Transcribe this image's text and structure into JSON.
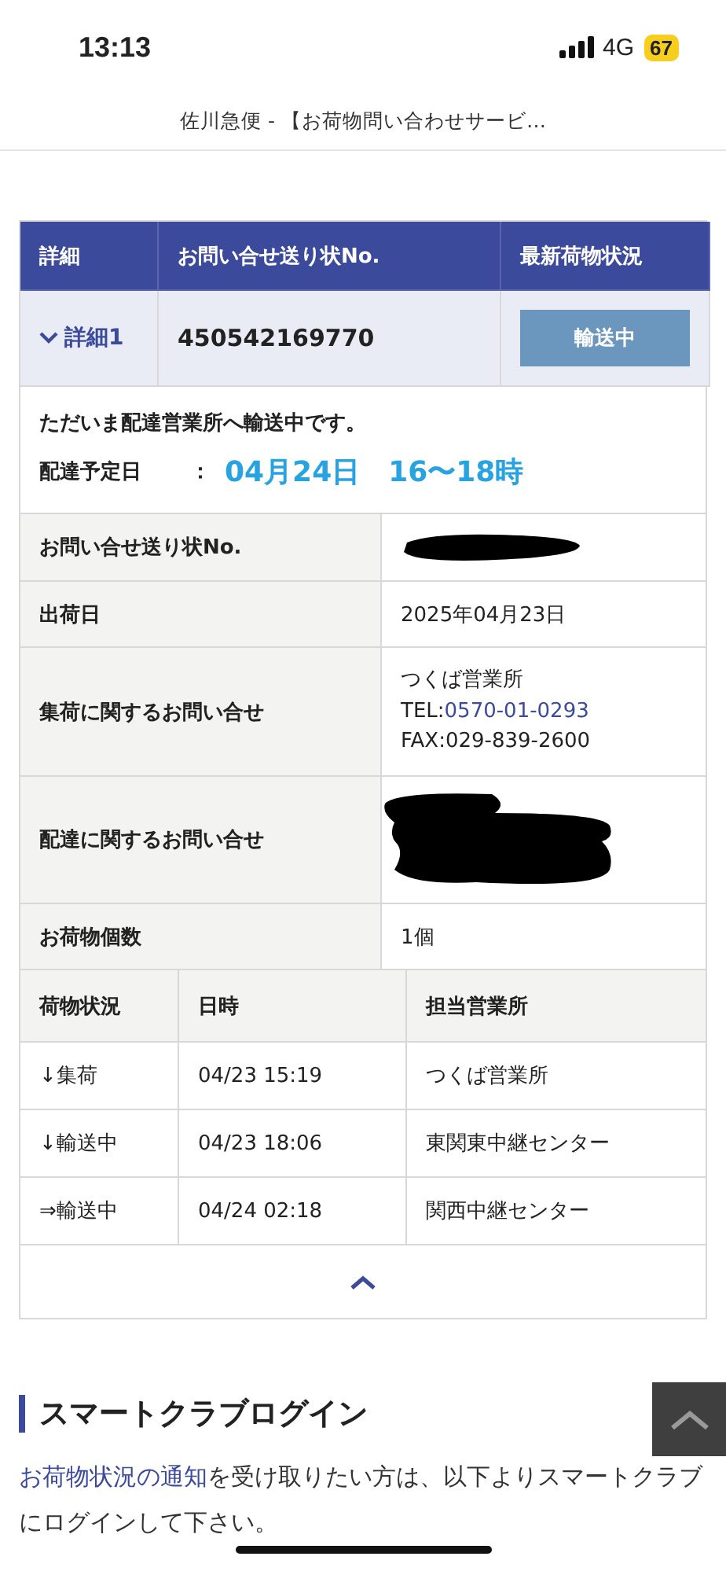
{
  "status_bar": {
    "time": "13:13",
    "network": "4G",
    "battery": "67"
  },
  "page_title": "佐川急便 - 【お荷物問い合わせサービ…",
  "summary_table": {
    "columns": [
      "詳細",
      "お問い合せ送り状No.",
      "最新荷物状況"
    ],
    "row": {
      "detail_link": "詳細1",
      "expanded": true,
      "tracking_no": "450542169770",
      "status": "輸送中"
    }
  },
  "message": "ただいま配達営業所へ輸送中です。",
  "delivery_eta": {
    "label": "配達予定日",
    "separator": "：",
    "date": "04月24日",
    "time": "16〜18時"
  },
  "info_rows": [
    {
      "kind": "redacted",
      "label": "お問い合せ送り状No."
    },
    {
      "kind": "text",
      "label": "出荷日",
      "value": "2025年04月23日"
    },
    {
      "kind": "contact",
      "label": "集荷に関するお問い合せ",
      "office": "つくば営業所",
      "tel_label": "TEL:",
      "tel": "0570-01-0293",
      "fax": "FAX:029-839-2600"
    },
    {
      "kind": "redacted",
      "label": "配達に関するお問い合せ"
    },
    {
      "kind": "text",
      "label": "お荷物個数",
      "value": "1個"
    }
  ],
  "history": {
    "columns": [
      "荷物状況",
      "日時",
      "担当営業所"
    ],
    "rows": [
      {
        "status": "↓集荷",
        "datetime": "04/23 15:19",
        "office": "つくば営業所"
      },
      {
        "status": "↓輸送中",
        "datetime": "04/23 18:06",
        "office": "東関東中継センター"
      },
      {
        "status": "⇒輸送中",
        "datetime": "04/24 02:18",
        "office": "関西中継センター"
      }
    ]
  },
  "login_section": {
    "title": "スマートクラブログイン",
    "link": "お荷物状況の通知",
    "text": "を受け取りたい方は、以下よりスマートクラブにログインして下さい。"
  }
}
